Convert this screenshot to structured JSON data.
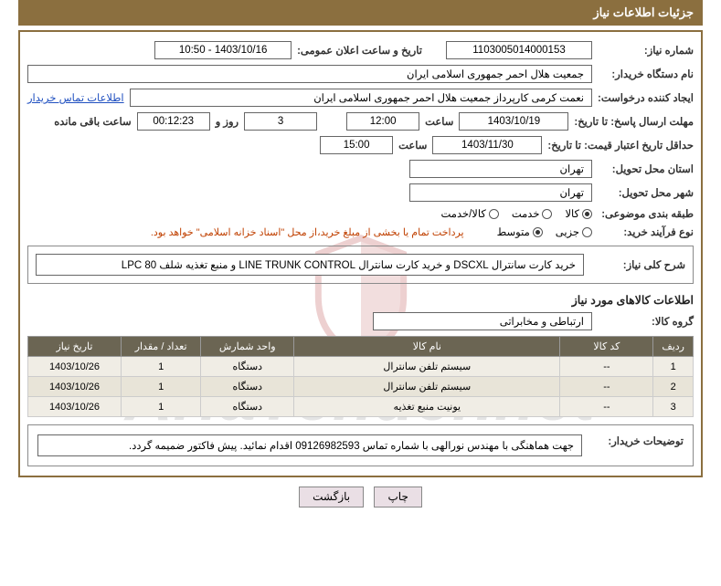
{
  "title": "جزئیات اطلاعات نیاز",
  "labels": {
    "need_no": "شماره نیاز:",
    "announce_dt": "تاریخ و ساعت اعلان عمومی:",
    "buyer_org": "نام دستگاه خریدار:",
    "requester": "ایجاد کننده درخواست:",
    "buyer_contact": "اطلاعات تماس خریدار",
    "response_deadline": "مهلت ارسال پاسخ: تا تاریخ:",
    "time_word": "ساعت",
    "days_and": "روز و",
    "time_remaining": "ساعت باقی مانده",
    "min_quote_validity": "حداقل تاریخ اعتبار قیمت: تا تاریخ:",
    "delivery_province": "استان محل تحویل:",
    "delivery_city": "شهر محل تحویل:",
    "subject_class": "طبقه بندی موضوعی:",
    "purchase_process": "نوع فرآیند خرید:",
    "payment_note": "پرداخت تمام یا بخشی از مبلغ خرید،از محل \"اسناد خزانه اسلامی\" خواهد بود.",
    "need_summary": "شرح کلی نیاز:",
    "goods_info": "اطلاعات کالاهای مورد نیاز",
    "goods_group": "گروه کالا:",
    "buyer_notes": "توضیحات خریدار:"
  },
  "fields": {
    "need_no": "1103005014000153",
    "announce_dt": "1403/10/16 - 10:50",
    "buyer_org": "جمعیت هلال احمر جمهوری اسلامی ایران",
    "requester": "نعمت کرمی کارپرداز جمعیت هلال احمر جمهوری اسلامی ایران",
    "response_date": "1403/10/19",
    "response_time": "12:00",
    "days_remaining": "3",
    "counter": "00:12:23",
    "quote_date": "1403/11/30",
    "quote_time": "15:00",
    "province": "تهران",
    "city": "تهران",
    "need_summary": "خرید کارت سانترال DSCXL و خرید کارت سانترال LINE TRUNK CONTROL و منبع تغذیه شلف LPC 80",
    "goods_group": "ارتباطی و مخابراتی",
    "buyer_notes": "جهت هماهنگی با مهندس نورالهی با شماره تماس 09126982593 اقدام نمائید. پیش فاکتور ضمیمه گردد."
  },
  "radios": {
    "subject": {
      "items": [
        "کالا",
        "خدمت",
        "کالا/خدمت"
      ],
      "selected": 0
    },
    "process": {
      "items": [
        "جزیی",
        "متوسط"
      ],
      "selected": 1
    }
  },
  "table": {
    "headers": [
      "ردیف",
      "کد کالا",
      "نام کالا",
      "واحد شمارش",
      "تعداد / مقدار",
      "تاریخ نیاز"
    ],
    "rows": [
      {
        "n": "1",
        "code": "--",
        "name": "سیستم تلفن سانترال",
        "unit": "دستگاه",
        "qty": "1",
        "date": "1403/10/26"
      },
      {
        "n": "2",
        "code": "--",
        "name": "سیستم تلفن سانترال",
        "unit": "دستگاه",
        "qty": "1",
        "date": "1403/10/26"
      },
      {
        "n": "3",
        "code": "--",
        "name": "یونیت منبع تغذیه",
        "unit": "دستگاه",
        "qty": "1",
        "date": "1403/10/26"
      }
    ]
  },
  "buttons": {
    "print": "چاپ",
    "back": "بازگشت"
  },
  "watermark": "AriaTender.net"
}
